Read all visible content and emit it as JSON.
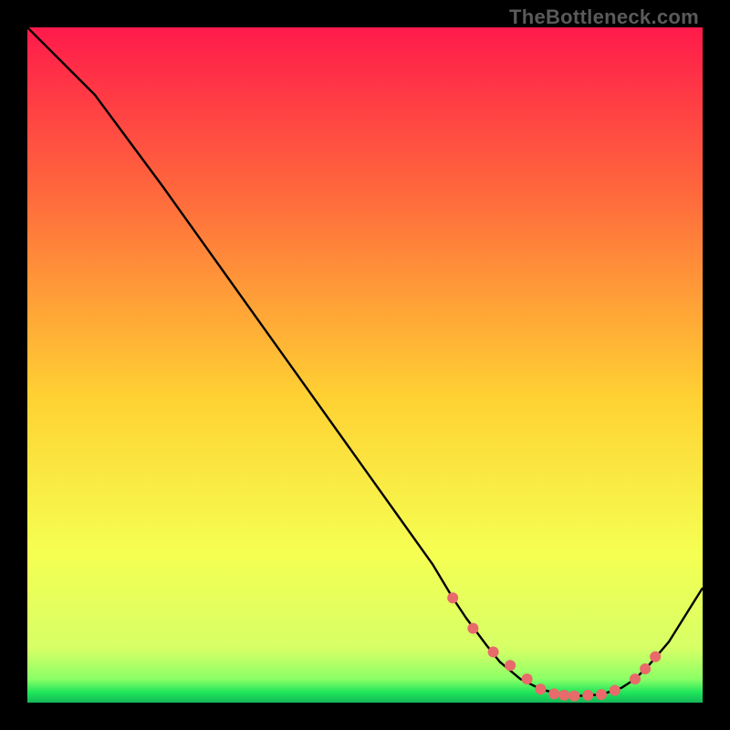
{
  "watermark": "TheBottleneck.com",
  "colors": {
    "gradient_top": "#ff1a4b",
    "gradient_mid_upper": "#ff6a3c",
    "gradient_mid": "#ffd233",
    "gradient_lower": "#f5ff52",
    "gradient_green": "#1ee65a",
    "line": "#000000",
    "marker": "#e86a6a",
    "frame": "#000000"
  },
  "chart_data": {
    "type": "line",
    "title": "",
    "xlabel": "",
    "ylabel": "",
    "xlim": [
      0,
      100
    ],
    "ylim": [
      0,
      100
    ],
    "grid": false,
    "legend": false,
    "series": [
      {
        "name": "curve",
        "x": [
          0,
          6,
          10,
          20,
          30,
          40,
          50,
          55,
          60,
          63,
          65,
          68,
          70,
          73,
          76,
          79,
          82,
          85,
          88,
          90,
          92,
          95,
          100
        ],
        "y": [
          100,
          94,
          90,
          76.5,
          62.5,
          48.5,
          34.5,
          27.5,
          20.5,
          15.5,
          12.5,
          8.5,
          6,
          3.5,
          2,
          1.2,
          1,
          1.2,
          2.2,
          3.5,
          5.5,
          9,
          17
        ]
      }
    ],
    "markers": {
      "name": "highlight-points",
      "x": [
        63,
        66,
        69,
        71.5,
        74,
        76,
        78,
        79.5,
        81,
        83,
        85,
        87,
        90,
        91.5,
        93
      ],
      "y": [
        15.5,
        11,
        7.5,
        5.5,
        3.5,
        2,
        1.3,
        1.1,
        1,
        1.1,
        1.2,
        1.8,
        3.5,
        5,
        6.8
      ]
    },
    "gradient_stops": [
      {
        "offset": 0.0,
        "color": "#ff1a4b"
      },
      {
        "offset": 0.25,
        "color": "#ff6a3c"
      },
      {
        "offset": 0.55,
        "color": "#ffd233"
      },
      {
        "offset": 0.78,
        "color": "#f5ff52"
      },
      {
        "offset": 0.92,
        "color": "#d6ff66"
      },
      {
        "offset": 0.965,
        "color": "#8bff66"
      },
      {
        "offset": 0.985,
        "color": "#1ee65a"
      },
      {
        "offset": 1.0,
        "color": "#14b858"
      }
    ]
  }
}
